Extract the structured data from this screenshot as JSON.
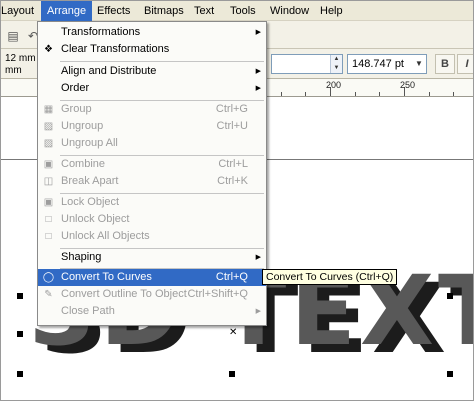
{
  "menubar": {
    "items": [
      "Layout",
      "Arrange",
      "Effects",
      "Bitmaps",
      "Text",
      "Tools",
      "Window",
      "Help"
    ]
  },
  "propbar": {
    "dim_top": "12 mm",
    "dim_bottom": "mm",
    "size_value": "148.747 pt"
  },
  "ruler": {
    "labels": [
      "200",
      "250"
    ]
  },
  "arrange_menu": {
    "items": [
      {
        "label": "Transformations",
        "shortcut": "",
        "submenu": true,
        "enabled": true
      },
      {
        "label": "Clear Transformations",
        "shortcut": "",
        "submenu": false,
        "enabled": true
      },
      {
        "label": "Align and Distribute",
        "shortcut": "",
        "submenu": true,
        "enabled": true
      },
      {
        "label": "Order",
        "shortcut": "",
        "submenu": true,
        "enabled": true
      },
      {
        "label": "Group",
        "shortcut": "Ctrl+G",
        "submenu": false,
        "enabled": false
      },
      {
        "label": "Ungroup",
        "shortcut": "Ctrl+U",
        "submenu": false,
        "enabled": false
      },
      {
        "label": "Ungroup All",
        "shortcut": "",
        "submenu": false,
        "enabled": false
      },
      {
        "label": "Combine",
        "shortcut": "Ctrl+L",
        "submenu": false,
        "enabled": false
      },
      {
        "label": "Break  Apart",
        "shortcut": "Ctrl+K",
        "submenu": false,
        "enabled": false
      },
      {
        "label": "Lock Object",
        "shortcut": "",
        "submenu": false,
        "enabled": false
      },
      {
        "label": "Unlock Object",
        "shortcut": "",
        "submenu": false,
        "enabled": false
      },
      {
        "label": "Unlock All Objects",
        "shortcut": "",
        "submenu": false,
        "enabled": false
      },
      {
        "label": "Shaping",
        "shortcut": "",
        "submenu": true,
        "enabled": true
      },
      {
        "label": "Convert To Curves",
        "shortcut": "Ctrl+Q",
        "submenu": false,
        "enabled": true,
        "highlighted": true
      },
      {
        "label": "Convert Outline To Object",
        "shortcut": "Ctrl+Shift+Q",
        "submenu": false,
        "enabled": false
      },
      {
        "label": "Close Path",
        "shortcut": "",
        "submenu": true,
        "enabled": false
      }
    ]
  },
  "tooltip": {
    "text": "Convert To Curves (Ctrl+Q)"
  },
  "canvas": {
    "art_text": "3D TEXT"
  },
  "icons": {
    "transform": "transform-icon",
    "clear_transform": "clear-transformations-icon",
    "group": "group-icon",
    "ungroup": "ungroup-icon",
    "ungroup_all": "ungroup-all-icon",
    "combine": "combine-icon",
    "break_apart": "break-apart-icon",
    "lock": "lock-icon",
    "unlock": "unlock-icon",
    "unlock_all": "unlock-all-icon",
    "convert_curves": "convert-to-curves-icon",
    "convert_outline": "convert-outline-icon"
  },
  "colors": {
    "highlight": "#316ac5",
    "menubar_bg": "#ece9d8",
    "disabled_text": "#9d9d9d",
    "tooltip_bg": "#ffffe1"
  }
}
